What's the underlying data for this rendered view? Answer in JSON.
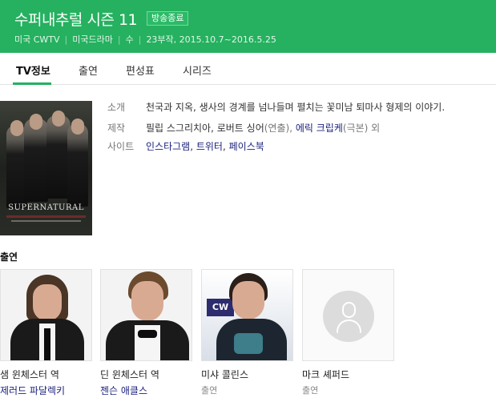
{
  "header": {
    "title": "수퍼내추럴 시즌 11",
    "badge": "방송종료",
    "meta": [
      "미국 CWTV",
      "미국드라마",
      "수",
      "23부작, 2015.10.7~2016.5.25"
    ]
  },
  "tabs": [
    {
      "label": "TV정보",
      "active": true
    },
    {
      "label": "출연",
      "active": false
    },
    {
      "label": "편성표",
      "active": false
    },
    {
      "label": "시리즈",
      "active": false
    }
  ],
  "poster": {
    "logo_text": "SUPERNATURAL"
  },
  "info": {
    "intro_label": "소개",
    "intro_text": "천국과 지옥, 생사의 경계를 넘나들며 펼치는 꽃미남 퇴마사 형제의 이야기.",
    "production_label": "제작",
    "production_people": "필립 스그리치아, 로버트 싱어",
    "production_note1": "(연출),",
    "production_writer": "에릭 크립케",
    "production_note2": "(극본) 외",
    "site_label": "사이트",
    "sites": [
      "인스타그램",
      "트위터",
      "페이스북"
    ]
  },
  "cast": {
    "heading": "출연",
    "members": [
      {
        "role": "샘 윈체스터 역",
        "actor": "제러드 파달렉키"
      },
      {
        "role": "딘 윈체스터 역",
        "actor": "젠슨 애클스"
      },
      {
        "role": "미샤 콜린스",
        "actor": "출연"
      },
      {
        "role": "마크 셰퍼드",
        "actor": "출연"
      }
    ]
  },
  "colors": {
    "header_bg": "#25b15f",
    "link": "#1a1f7a",
    "tab_underline": "#25b15f"
  }
}
